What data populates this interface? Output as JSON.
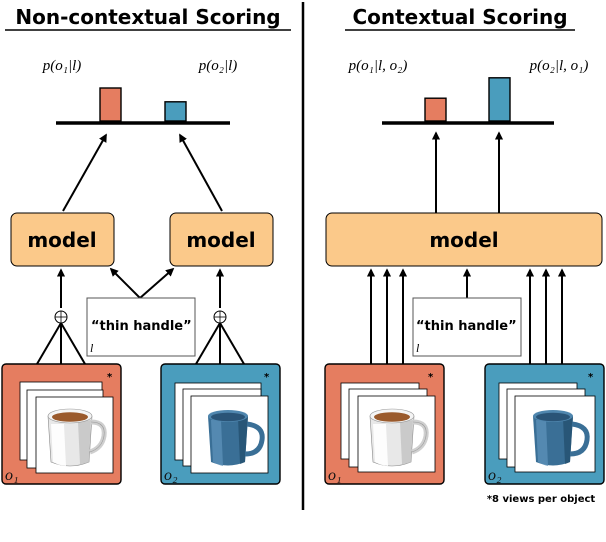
{
  "colors": {
    "object1": "#e57d60",
    "object2": "#4a9dbd",
    "model": "#fbc98a",
    "mug_coffee": "#9a5a2c",
    "mug_blue": "#3a6f96"
  },
  "left_panel": {
    "title": "Non-contextual Scoring",
    "score_labels": [
      "p(o₁|l)",
      "p(o₂|l)"
    ],
    "scores": [
      0.55,
      0.32
    ],
    "models": [
      "model",
      "model"
    ],
    "combine_symbol": "⊕",
    "language": {
      "text": "“thin handle”",
      "var": "l"
    },
    "objects": [
      {
        "label": "o₁",
        "star": "*",
        "kind": "white coffee mug"
      },
      {
        "label": "o₂",
        "star": "*",
        "kind": "blue mug"
      }
    ]
  },
  "right_panel": {
    "title": "Contextual Scoring",
    "score_labels": [
      "p(o₁|l, o₂)",
      "p(o₂|l, o₁)"
    ],
    "scores": [
      0.38,
      0.72
    ],
    "model": "model",
    "language": {
      "text": "“thin handle”",
      "var": "l"
    },
    "objects": [
      {
        "label": "o₁",
        "star": "*",
        "kind": "white coffee mug"
      },
      {
        "label": "o₂",
        "star": "*",
        "kind": "blue mug"
      }
    ],
    "footnote": "*8 views per object"
  }
}
